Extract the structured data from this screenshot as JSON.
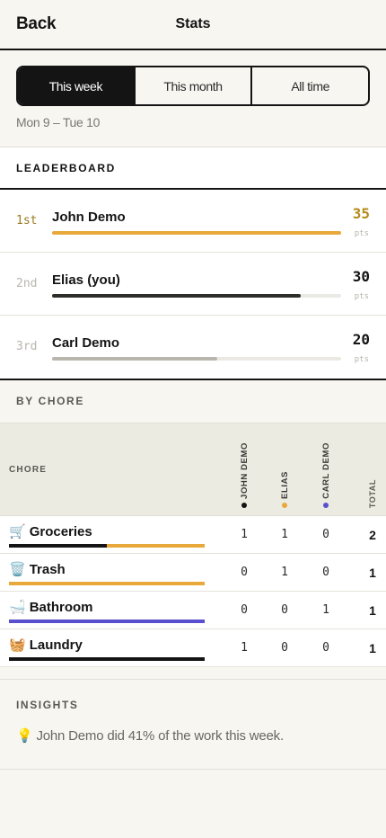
{
  "header": {
    "back_label": "Back",
    "title": "Stats"
  },
  "period_tabs": [
    {
      "label": "This week",
      "active": true
    },
    {
      "label": "This month",
      "active": false
    },
    {
      "label": "All time",
      "active": false
    }
  ],
  "date_range": "Mon 9 – Tue 10",
  "leaderboard": {
    "heading": "LEADERBOARD",
    "pts_unit": "pts",
    "entries": [
      {
        "rank": "1st",
        "name": "John Demo",
        "points": "35",
        "progress": 1.0,
        "color": "#e8a93a"
      },
      {
        "rank": "2nd",
        "name": "Elias (you)",
        "points": "30",
        "progress": 0.86,
        "color": "#2d2d2a"
      },
      {
        "rank": "3rd",
        "name": "Carl Demo",
        "points": "20",
        "progress": 0.57,
        "color": "#b9b6ae"
      }
    ]
  },
  "by_chore": {
    "heading": "BY CHORE",
    "columns": {
      "chore": "CHORE",
      "people": [
        {
          "label": "JOHN DEMO",
          "dot": "#141414"
        },
        {
          "label": "ELIAS",
          "dot": "#e8a93a"
        },
        {
          "label": "CARL DEMO",
          "dot": "#5a4fcf"
        }
      ],
      "total": "TOTAL"
    },
    "rows": [
      {
        "emoji": "🛒",
        "name": "Groceries",
        "counts": [
          "1",
          "1",
          "0"
        ],
        "total": "2",
        "bar": [
          {
            "share": 0.5,
            "color": "#141414"
          },
          {
            "share": 0.5,
            "color": "#e8a93a"
          }
        ]
      },
      {
        "emoji": "🗑️",
        "name": "Trash",
        "counts": [
          "0",
          "1",
          "0"
        ],
        "total": "1",
        "bar": [
          {
            "share": 1.0,
            "color": "#e8a93a"
          }
        ]
      },
      {
        "emoji": "🛁",
        "name": "Bathroom",
        "counts": [
          "0",
          "0",
          "1"
        ],
        "total": "1",
        "bar": [
          {
            "share": 1.0,
            "color": "#5a4fcf"
          }
        ]
      },
      {
        "emoji": "🧺",
        "name": "Laundry",
        "counts": [
          "1",
          "0",
          "0"
        ],
        "total": "1",
        "bar": [
          {
            "share": 1.0,
            "color": "#141414"
          }
        ]
      }
    ]
  },
  "insights": {
    "heading": "INSIGHTS",
    "emoji": "💡",
    "text": "John Demo did 41% of the work this week."
  }
}
